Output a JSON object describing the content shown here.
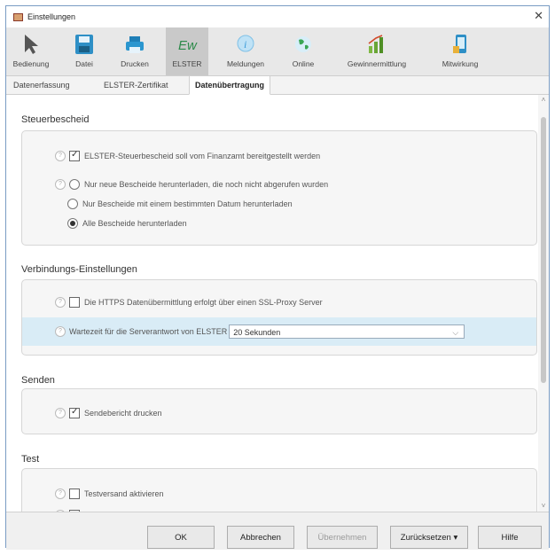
{
  "window": {
    "title": "Einstellungen"
  },
  "toolbar": {
    "items": [
      {
        "label": "Bedienung",
        "icon": "cursor-icon"
      },
      {
        "label": "Datei",
        "icon": "save-icon"
      },
      {
        "label": "Drucken",
        "icon": "printer-icon"
      },
      {
        "label": "ELSTER",
        "icon": "elster-icon"
      },
      {
        "label": "Meldungen",
        "icon": "info-icon"
      },
      {
        "label": "Online",
        "icon": "globe-icon"
      },
      {
        "label": "Gewinnermittlung",
        "icon": "chart-icon"
      },
      {
        "label": "Mitwirkung",
        "icon": "phone-icon"
      }
    ],
    "active": "ELSTER"
  },
  "subtabs": {
    "items": [
      "Datenerfassung",
      "ELSTER-Zertifikat",
      "Datenübertragung"
    ],
    "active": "Datenübertragung"
  },
  "sections": {
    "steuerbescheid": {
      "title": "Steuerbescheid",
      "checkbox_label": "ELSTER-Steuerbescheid soll vom Finanzamt bereitgestellt werden",
      "checkbox_checked": true,
      "radio_1": "Nur neue Bescheide herunterladen, die noch nicht abgerufen wurden",
      "radio_2": "Nur Bescheide mit einem bestimmten Datum herunterladen",
      "radio_3": "Alle Bescheide herunterladen",
      "radio_selected": 3
    },
    "verbindung": {
      "title": "Verbindungs-Einstellungen",
      "https_label": "Die HTTPS Datenübermittlung erfolgt über einen SSL-Proxy Server",
      "https_checked": false,
      "wait_label": "Wartezeit für die Serverantwort von ELSTER",
      "wait_value": "20 Sekunden"
    },
    "senden": {
      "title": "Senden",
      "report_label": "Sendebericht drucken",
      "report_checked": true
    },
    "test": {
      "title": "Test",
      "test_label": "Testversand aktivieren",
      "test_checked": false
    }
  },
  "footer": {
    "ok": "OK",
    "cancel": "Abbrechen",
    "apply": "Übernehmen",
    "reset": "Zurücksetzen",
    "help": "Hilfe"
  }
}
